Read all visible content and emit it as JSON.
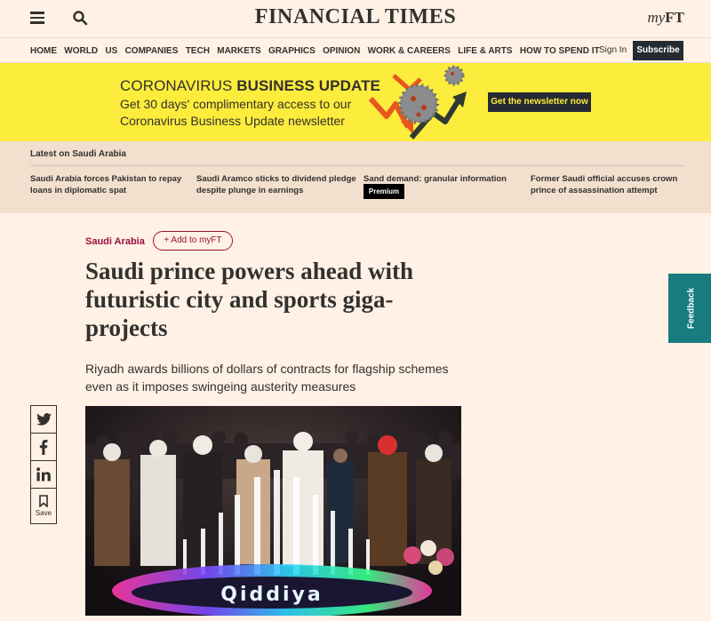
{
  "header": {
    "logo": "FINANCIAL TIMES",
    "myft_my": "my",
    "myft_ft": "FT"
  },
  "nav": {
    "items": [
      "HOME",
      "WORLD",
      "US",
      "COMPANIES",
      "TECH",
      "MARKETS",
      "GRAPHICS",
      "OPINION",
      "WORK & CAREERS",
      "LIFE & ARTS",
      "HOW TO SPEND IT"
    ],
    "sign_in": "Sign In",
    "subscribe": "Subscribe"
  },
  "promo": {
    "title_plain": "CORONAVIRUS ",
    "title_bold": "BUSINESS UPDATE",
    "line1": "Get 30 days' complimentary access to our",
    "line2": "Coronavirus Business Update newsletter",
    "button": "Get the newsletter now"
  },
  "latest": {
    "title": "Latest on Saudi Arabia",
    "items": [
      "Saudi Arabia forces Pakistan to repay loans in diplomatic spat",
      "Saudi Aramco sticks to dividend pledge despite plunge in earnings",
      "Sand demand: granular information",
      "Former Saudi official accuses crown prince of assassination attempt"
    ],
    "premium_badge": "Premium"
  },
  "article": {
    "topic": "Saudi Arabia",
    "add_to_myft": "+ Add to myFT",
    "headline": "Saudi prince powers ahead with futuristic city and sports giga-projects",
    "standfirst": "Riyadh awards billions of dollars of contracts for flagship schemes even as it imposes swingeing austerity measures",
    "photo_sign": "Qiddiya"
  },
  "share": {
    "save_label": "Save"
  },
  "feedback": {
    "label": "Feedback"
  },
  "colors": {
    "page_bg": "#fff1e5",
    "promo_yellow": "#fcec3c",
    "topic_claret": "#990f3d",
    "feedback_teal": "#177b80",
    "dark": "#262a33"
  }
}
